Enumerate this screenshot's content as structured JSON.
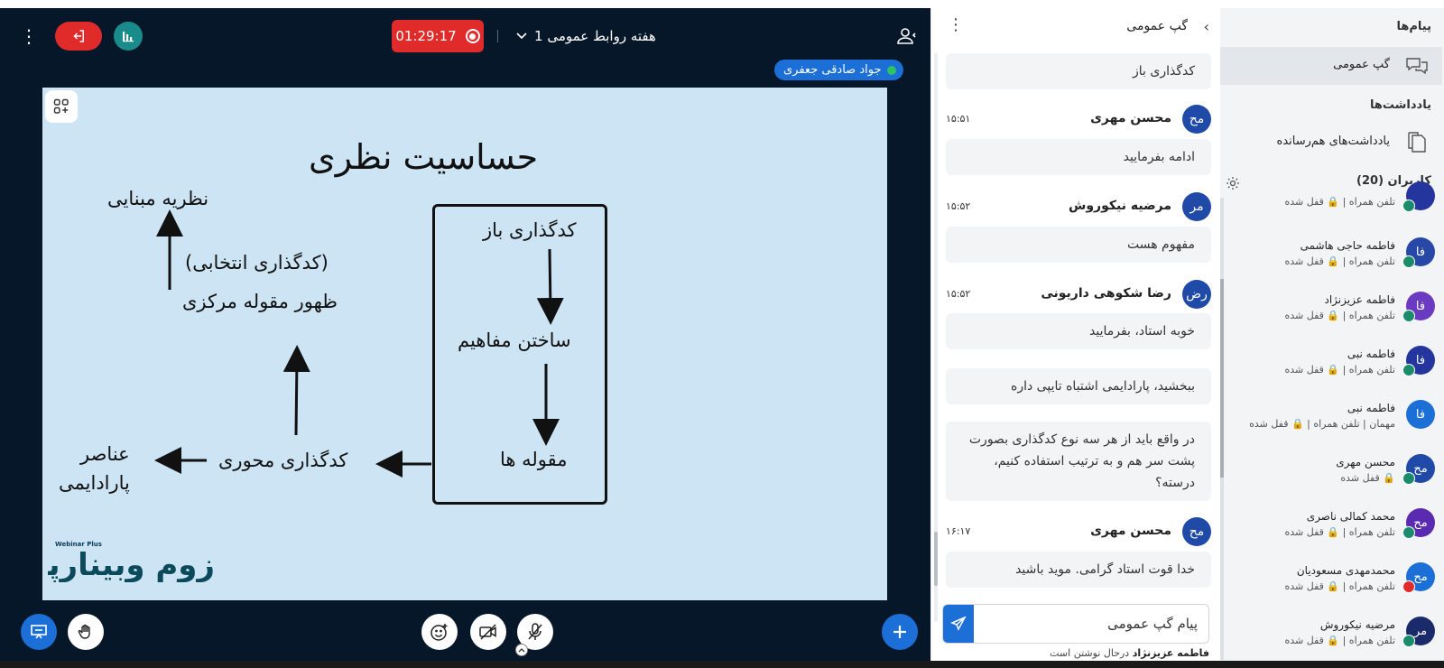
{
  "header": {
    "timer": "01:29:17",
    "meeting_title": "هفته روابط عمومی 1",
    "speaker": "جواد صادقی جعفری"
  },
  "slide": {
    "title": "حساسیت نظری",
    "texts": {
      "grounded_theory": "نظریه مبنایی",
      "selective_coding": "(کدگذاری انتخابی)",
      "core_category": "ظهور مقوله مرکزی",
      "open_coding": "کدگذاری باز",
      "building_concepts": "ساختن مفاهیم",
      "categories": "مقوله ها",
      "axial_coding": "کدگذاری محوری",
      "paradigm_line1": "عناصر",
      "paradigm_line2": "پارادایمی"
    },
    "logo_text": "زوم وبینارپلاس",
    "logo_subtext": "Webinar Plus"
  },
  "chat": {
    "title": "گپ عمومی",
    "input_placeholder": "پیام گپ عمومی",
    "typing_user": "فاطمه عزیزنژاد",
    "typing_suffix": "درحال نوشتن است",
    "messages": [
      {
        "text": "کدگذاری باز"
      },
      {
        "avatar": "مح",
        "name": "محسن مهری",
        "time": "۱۵:۵۱",
        "text": "ادامه بفرمایید"
      },
      {
        "avatar": "مر",
        "name": "مرضیه نیکوروش",
        "time": "۱۵:۵۲",
        "text": "مفهوم هست"
      },
      {
        "avatar": "رض",
        "name": "رضا شکوهی داریونی",
        "time": "۱۵:۵۲",
        "text": "خوبه استاد، بفرمایید"
      },
      {
        "text": "ببخشید، پارادایمی اشتباه تایپی داره"
      },
      {
        "text": "در واقع باید از هر سه نوع کدگذاری بصورت پشت سر هم و به ترتیب استفاده کنیم، درسته؟"
      },
      {
        "avatar": "مح",
        "name": "محسن مهری",
        "time": "۱۶:۱۷",
        "text": "خدا قوت استاد گرامی. موید باشید"
      }
    ]
  },
  "sidebar": {
    "messages_heading": "پیام‌ها",
    "public_chat": "گپ عمومی",
    "notes_heading": "یادداشت‌ها",
    "shared_notes": "یادداشت‌های هم‌رسانده",
    "users_heading": "کاربران (20)",
    "users": [
      {
        "avatar": "",
        "name": "",
        "sub": "تلفن همراه | 🔒 قفل شده",
        "color": "#24369e"
      },
      {
        "avatar": "فا",
        "name": "فاطمه حاجی هاشمی",
        "sub": "تلفن همراه | 🔒 قفل شده",
        "color": "#2848a8"
      },
      {
        "avatar": "فا",
        "name": "فاطمه عزیزنژاد",
        "sub": "تلفن همراه | 🔒 قفل شده",
        "color": "#6a3ac0"
      },
      {
        "avatar": "فا",
        "name": "فاطمه نبی",
        "sub": "تلفن همراه | 🔒 قفل شده",
        "color": "#24369e"
      },
      {
        "avatar": "فا",
        "name": "فاطمه نبی",
        "sub": "مهمان | تلفن همراه | 🔒 قفل شده",
        "color": "#1b6fd6"
      },
      {
        "avatar": "مح",
        "name": "محسن مهری",
        "sub": "🔒 قفل شده",
        "color": "#1f4aa8"
      },
      {
        "avatar": "مح",
        "name": "محمد کمالی ناصری",
        "sub": "تلفن همراه | 🔒 قفل شده",
        "color": "#5a2ab0"
      },
      {
        "avatar": "مح",
        "name": "محمدمهدی مسعودیان",
        "sub": "تلفن همراه | 🔒 قفل شده",
        "color": "#1b6fd6"
      },
      {
        "avatar": "مر",
        "name": "مرضیه نیکوروش",
        "sub": "تلفن همراه | 🔒 قفل شده",
        "color": "#1a2a6a"
      }
    ]
  },
  "colors": {
    "accent": "#1b6fd6",
    "danger": "#e12b2b",
    "main_bg": "#06172a",
    "slide_bg": "#cce4f4"
  }
}
